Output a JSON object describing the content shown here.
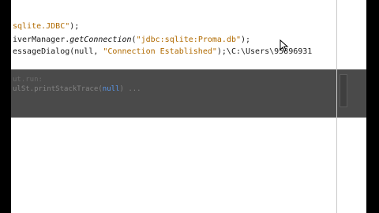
{
  "editor": {
    "lines": [
      {
        "pre": "",
        "str": "sqlite.JDBC\"",
        "post": ");"
      },
      {
        "pre": "iverManager.",
        "method": "getConnection",
        "paren": "(",
        "str": "\"jdbc:sqlite:Proma.db\"",
        "post": ");"
      },
      {
        "pre": "essageDialog(null, ",
        "str": "\"Connection Established\"",
        "post": ");\\C:\\Users\\95896931"
      }
    ]
  },
  "output": {
    "line1": "ut.run:",
    "line2_pre": "ulSt.printStackTrace(",
    "line2_highlight": "null",
    "line2_post": ") ..."
  },
  "colors": {
    "gutter": "#000000",
    "output_background": "#4a4a4a",
    "string": "#b06a00"
  }
}
